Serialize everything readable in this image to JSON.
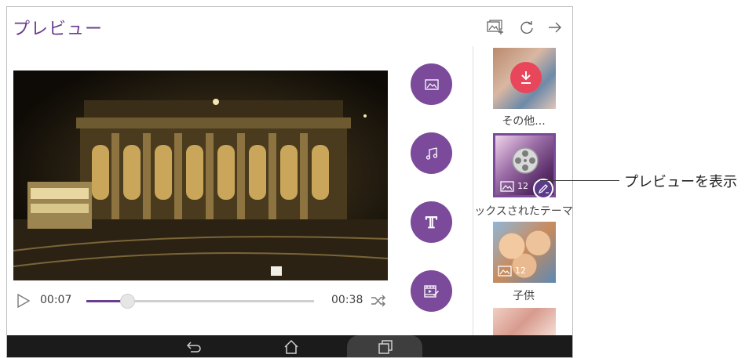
{
  "header": {
    "title": "プレビュー",
    "icons": [
      "add-photo-icon",
      "refresh-icon",
      "arrow-right-icon"
    ]
  },
  "player": {
    "current_time": "00:07",
    "total_time": "00:38",
    "progress": 0.18
  },
  "side_buttons": [
    "image-icon",
    "music-icon",
    "text-icon",
    "edit-video-icon"
  ],
  "themes": [
    {
      "label": "その他...",
      "icon": "download-icon"
    },
    {
      "label": "ックスされたテーマ",
      "count": "12",
      "selected": true,
      "icon": "edit-icon"
    },
    {
      "label": "子供",
      "count": "12"
    }
  ],
  "navbar": {
    "icons": [
      "back-icon",
      "home-icon",
      "recent-apps-icon"
    ]
  },
  "callout": {
    "text": "プレビューを表示"
  },
  "colors": {
    "accent": "#7b4a9b",
    "title": "#6b3d8d",
    "download": "#e8465a",
    "navbar": "#1b1b1b"
  }
}
